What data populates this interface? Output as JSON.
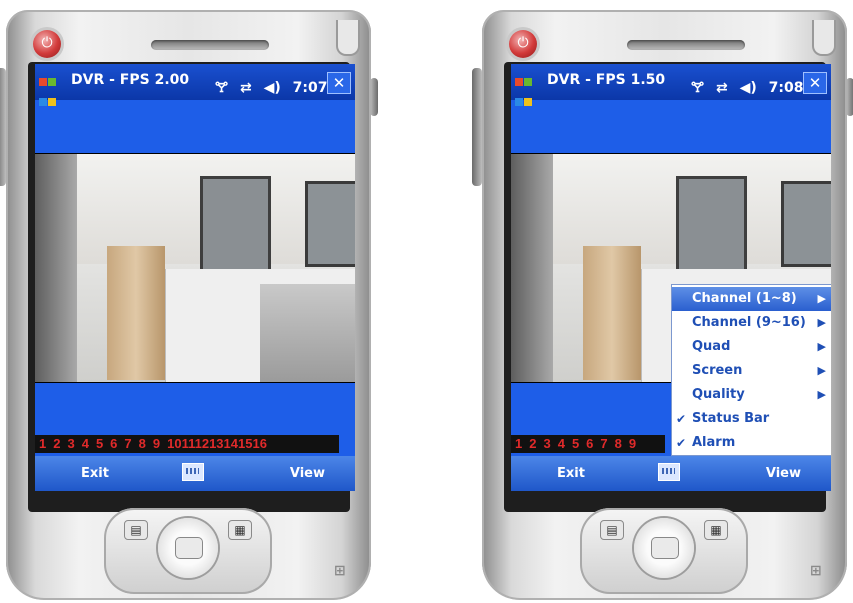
{
  "devices": [
    {
      "title": "DVR - FPS 2.00",
      "time": "7:07",
      "close_label": "✕",
      "channels": [
        "1",
        "2",
        "3",
        "4",
        "5",
        "6",
        "7",
        "8",
        "9",
        "10",
        "11",
        "12",
        "13",
        "14",
        "15",
        "16"
      ],
      "soft_left": "Exit",
      "soft_right": "View"
    },
    {
      "title": "DVR - FPS 1.50",
      "time": "7:08",
      "close_label": "✕",
      "channels": [
        "1",
        "2",
        "3",
        "4",
        "5",
        "6",
        "7",
        "8",
        "9"
      ],
      "soft_left": "Exit",
      "soft_right": "View",
      "menu": {
        "items": [
          {
            "label": "Channel (1~8)",
            "submenu": true,
            "checked": false,
            "selected": true
          },
          {
            "label": "Channel (9~16)",
            "submenu": true,
            "checked": false,
            "selected": false
          },
          {
            "label": "Quad",
            "submenu": true,
            "checked": false,
            "selected": false
          },
          {
            "label": "Screen",
            "submenu": true,
            "checked": false,
            "selected": false
          },
          {
            "label": "Quality",
            "submenu": true,
            "checked": false,
            "selected": false
          },
          {
            "label": "Status Bar",
            "submenu": false,
            "checked": true,
            "selected": false
          },
          {
            "label": "Alarm",
            "submenu": false,
            "checked": true,
            "selected": false
          }
        ]
      }
    }
  ],
  "icons": {
    "start": "windows-start-icon",
    "signal": "antenna-icon",
    "sync": "connectivity-icon",
    "volume": "speaker-icon",
    "keyboard": "keyboard-icon",
    "power": "power-icon"
  },
  "colors": {
    "screen_bg": "#1e5ee8",
    "channel_text": "#e02a2a",
    "menu_text": "#1f4fb5"
  }
}
